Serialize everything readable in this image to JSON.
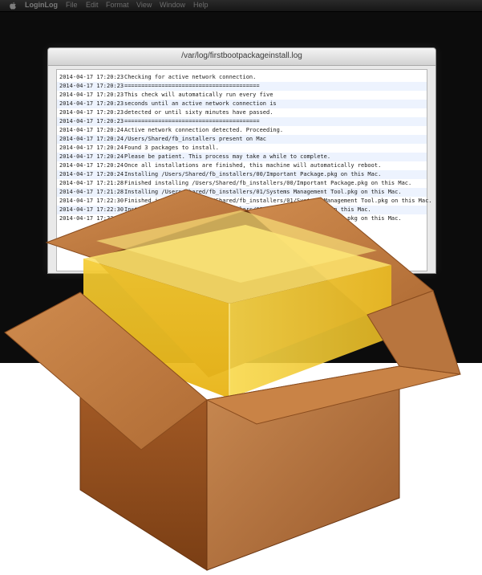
{
  "menubar": {
    "app_name": "LoginLog",
    "items": [
      "File",
      "Edit",
      "Format",
      "View",
      "Window",
      "Help"
    ]
  },
  "window": {
    "title": "/var/log/firstbootpackageinstall.log"
  },
  "log_lines": [
    {
      "ts": "2014-04-17 17:20:23",
      "msg": "Checking for active network connection."
    },
    {
      "ts": "2014-04-17 17:20:23",
      "msg": "========================================"
    },
    {
      "ts": "2014-04-17 17:20:23",
      "msg": "This check will automatically run every five"
    },
    {
      "ts": "2014-04-17 17:20:23",
      "msg": "seconds until an active network connection is"
    },
    {
      "ts": "2014-04-17 17:20:23",
      "msg": "detected or until sixty minutes have passed."
    },
    {
      "ts": "2014-04-17 17:20:23",
      "msg": "========================================"
    },
    {
      "ts": "2014-04-17 17:20:24",
      "msg": "Active network connection detected. Proceeding."
    },
    {
      "ts": "2014-04-17 17:20:24",
      "msg": "/Users/Shared/fb_installers present on Mac"
    },
    {
      "ts": "2014-04-17 17:20:24",
      "msg": "Found 3 packages to install."
    },
    {
      "ts": "2014-04-17 17:20:24",
      "msg": "Please be patient. This process may take a while to complete."
    },
    {
      "ts": "2014-04-17 17:20:24",
      "msg": "Once all installations are finished, this machine will automatically reboot."
    },
    {
      "ts": "2014-04-17 17:20:24",
      "msg": "Installing /Users/Shared/fb_installers/00/Important Package.pkg on this Mac."
    },
    {
      "ts": "2014-04-17 17:21:28",
      "msg": "Finished installing /Users/Shared/fb_installers/00/Important Package.pkg on this Mac."
    },
    {
      "ts": "2014-04-17 17:21:28",
      "msg": "Installing /Users/Shared/fb_installers/01/Systems Management Tool.pkg on this Mac."
    },
    {
      "ts": "2014-04-17 17:22:30",
      "msg": "Finished installing /Users/Shared/fb_installers/01/Systems Management Tool.pkg on this Mac."
    },
    {
      "ts": "2014-04-17 17:22:30",
      "msg": "Installing /Users/Shared/fb_installers/02/All My Scripts.pkg on this Mac."
    },
    {
      "ts": "2014-04-17 17:23:33",
      "msg": "Finished installing /Users/Shared/fb_installers/02/All My Scripts.pkg on this Mac."
    }
  ],
  "colors": {
    "screen": "#0c0c0c",
    "log_alt_row": "#edf3fe",
    "box_cardboard": "#b7713a",
    "box_glow": "#f6cf2d"
  }
}
